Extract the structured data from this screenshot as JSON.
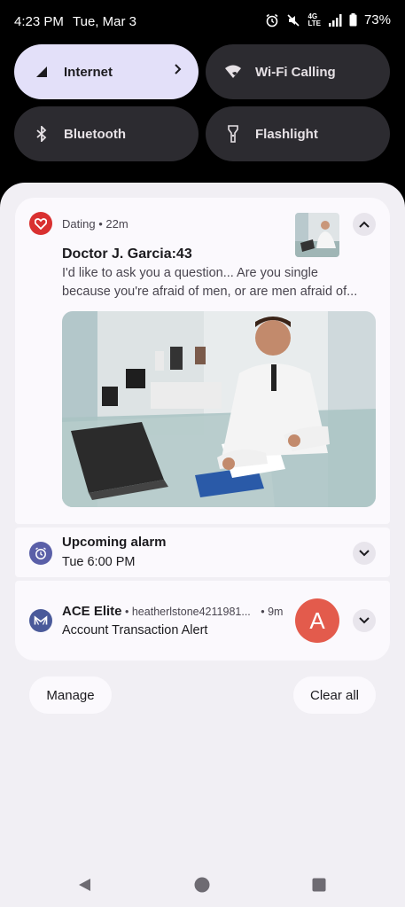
{
  "status_bar": {
    "time": "4:23 PM",
    "date": "Tue, Mar 3",
    "network_label": "4G",
    "network_sub": "LTE",
    "battery": "73%",
    "icons": [
      "alarm-icon",
      "mute-icon",
      "network-icon",
      "signal-icon",
      "battery-icon"
    ]
  },
  "quick_tiles": [
    {
      "label": "Internet",
      "icon": "signal-icon",
      "active": true
    },
    {
      "label": "Wi-Fi Calling",
      "icon": "wifi-calling-icon",
      "active": false
    },
    {
      "label": "Bluetooth",
      "icon": "bluetooth-icon",
      "active": false
    },
    {
      "label": "Flashlight",
      "icon": "flashlight-icon",
      "active": false
    }
  ],
  "notifications": {
    "dating": {
      "app": "Dating",
      "time": "22m",
      "title": "Doctor J. Garcia:43",
      "body_line1": "I'd  like to ask you a question... Are you single",
      "body_line2": "because you're afraid of men, or are men afraid of...",
      "accent": "#d93030"
    },
    "alarm": {
      "title": "Upcoming alarm",
      "text": "Tue 6:00 PM",
      "accent": "#5a5fa8"
    },
    "ace": {
      "app": "ACE Elite",
      "account": "heatherlstone4211981...",
      "time": "9m",
      "text": "Account Transaction Alert",
      "avatar_letter": "A",
      "accent": "#4a5a9a"
    }
  },
  "actions": {
    "manage": "Manage",
    "clear_all": "Clear all"
  },
  "colors": {
    "shade": "#f1eff4",
    "card": "#fbf9fd",
    "tile_active": "#e3e0f9",
    "tile_inactive": "#2c2b30",
    "avatar": "#e35b4c"
  }
}
